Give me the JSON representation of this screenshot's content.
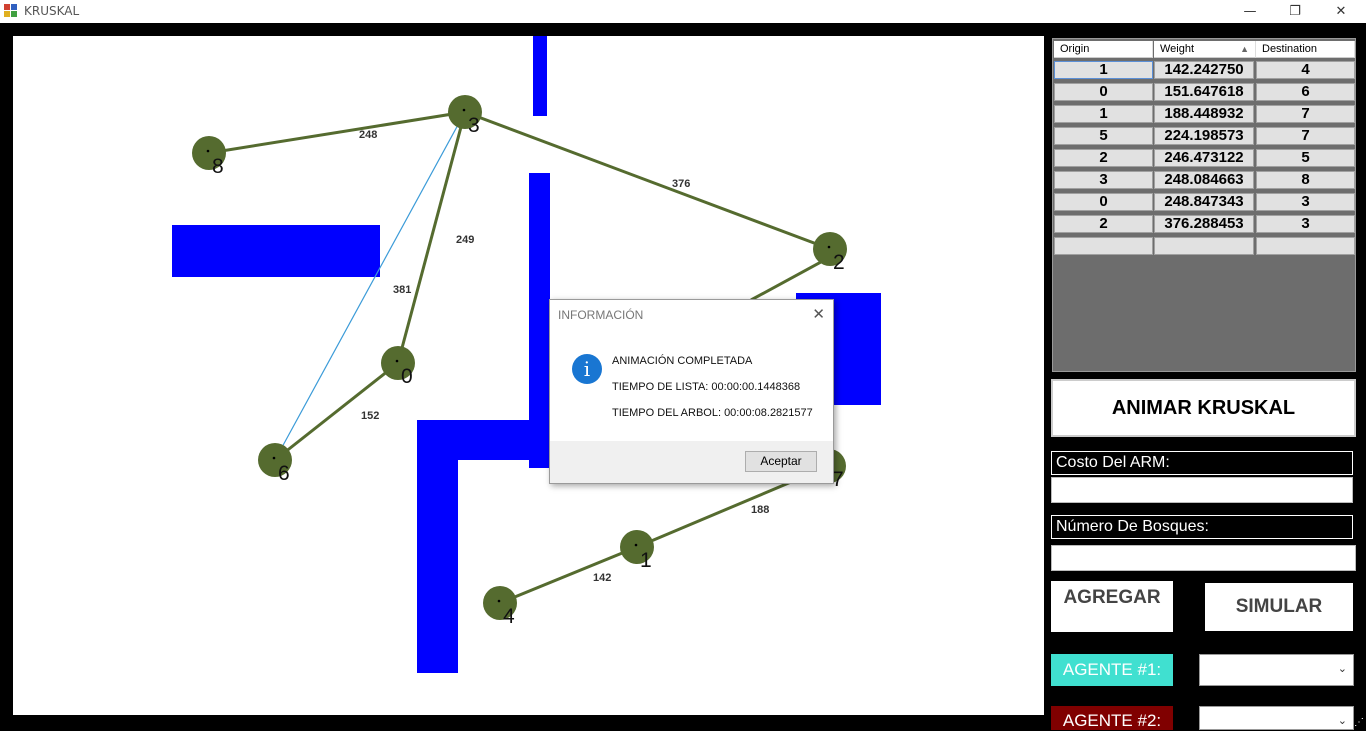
{
  "window": {
    "title": "KRUSKAL",
    "minimize_glyph": "—",
    "restore_glyph": "❐",
    "close_glyph": "✕"
  },
  "graph": {
    "nodes": [
      {
        "id": "0"
      },
      {
        "id": "1"
      },
      {
        "id": "2"
      },
      {
        "id": "3"
      },
      {
        "id": "4"
      },
      {
        "id": "6"
      },
      {
        "id": "7"
      },
      {
        "id": "8"
      }
    ],
    "edges": [
      {
        "from": "3",
        "to": "8",
        "label": "248"
      },
      {
        "from": "3",
        "to": "2",
        "label": "376"
      },
      {
        "from": "3",
        "to": "0",
        "label": "249"
      },
      {
        "from": "3",
        "to": "6",
        "label": "381"
      },
      {
        "from": "0",
        "to": "6",
        "label": "152"
      },
      {
        "from": "4",
        "to": "1",
        "label": "142"
      },
      {
        "from": "1",
        "to": "7",
        "label": "188"
      }
    ],
    "node_color": "#556b2f",
    "edge_color": "#556b2f",
    "highlight_edge_color": "#3b9bd8",
    "obstacle_color": "#0000ff"
  },
  "table": {
    "headers": [
      "Origin",
      "Weight",
      "Destination"
    ],
    "sort_glyph": "▲",
    "rows": [
      [
        "1",
        "142.242750",
        "4"
      ],
      [
        "0",
        "151.647618",
        "6"
      ],
      [
        "1",
        "188.448932",
        "7"
      ],
      [
        "5",
        "224.198573",
        "7"
      ],
      [
        "2",
        "246.473122",
        "5"
      ],
      [
        "3",
        "248.084663",
        "8"
      ],
      [
        "0",
        "248.847343",
        "3"
      ],
      [
        "2",
        "376.288453",
        "3"
      ],
      [
        "",
        "",
        ""
      ]
    ]
  },
  "panel": {
    "animate_label": "ANIMAR KRUSKAL",
    "cost_label": "Costo Del ARM:",
    "cost_value": "",
    "forests_label": "Número De Bosques:",
    "forests_value": "",
    "add_label": "AGREGAR",
    "simulate_label": "SIMULAR",
    "agent1_label": "AGENTE #1:",
    "agent2_label": "AGENTE #2:",
    "agent1_color": "#40e0d0",
    "agent2_color": "#800000",
    "agent1_value": "",
    "agent2_value": ""
  },
  "dialog": {
    "title": "INFORMACIÓN",
    "close_glyph": "✕",
    "icon_glyph": "i",
    "line1": "ANIMACIÓN COMPLETADA",
    "line2": "TIEMPO DE LISTA: 00:00:00.1448368",
    "line3": "TIEMPO DEL ARBOL: 00:00:08.2821577",
    "ok_label": "Aceptar"
  }
}
